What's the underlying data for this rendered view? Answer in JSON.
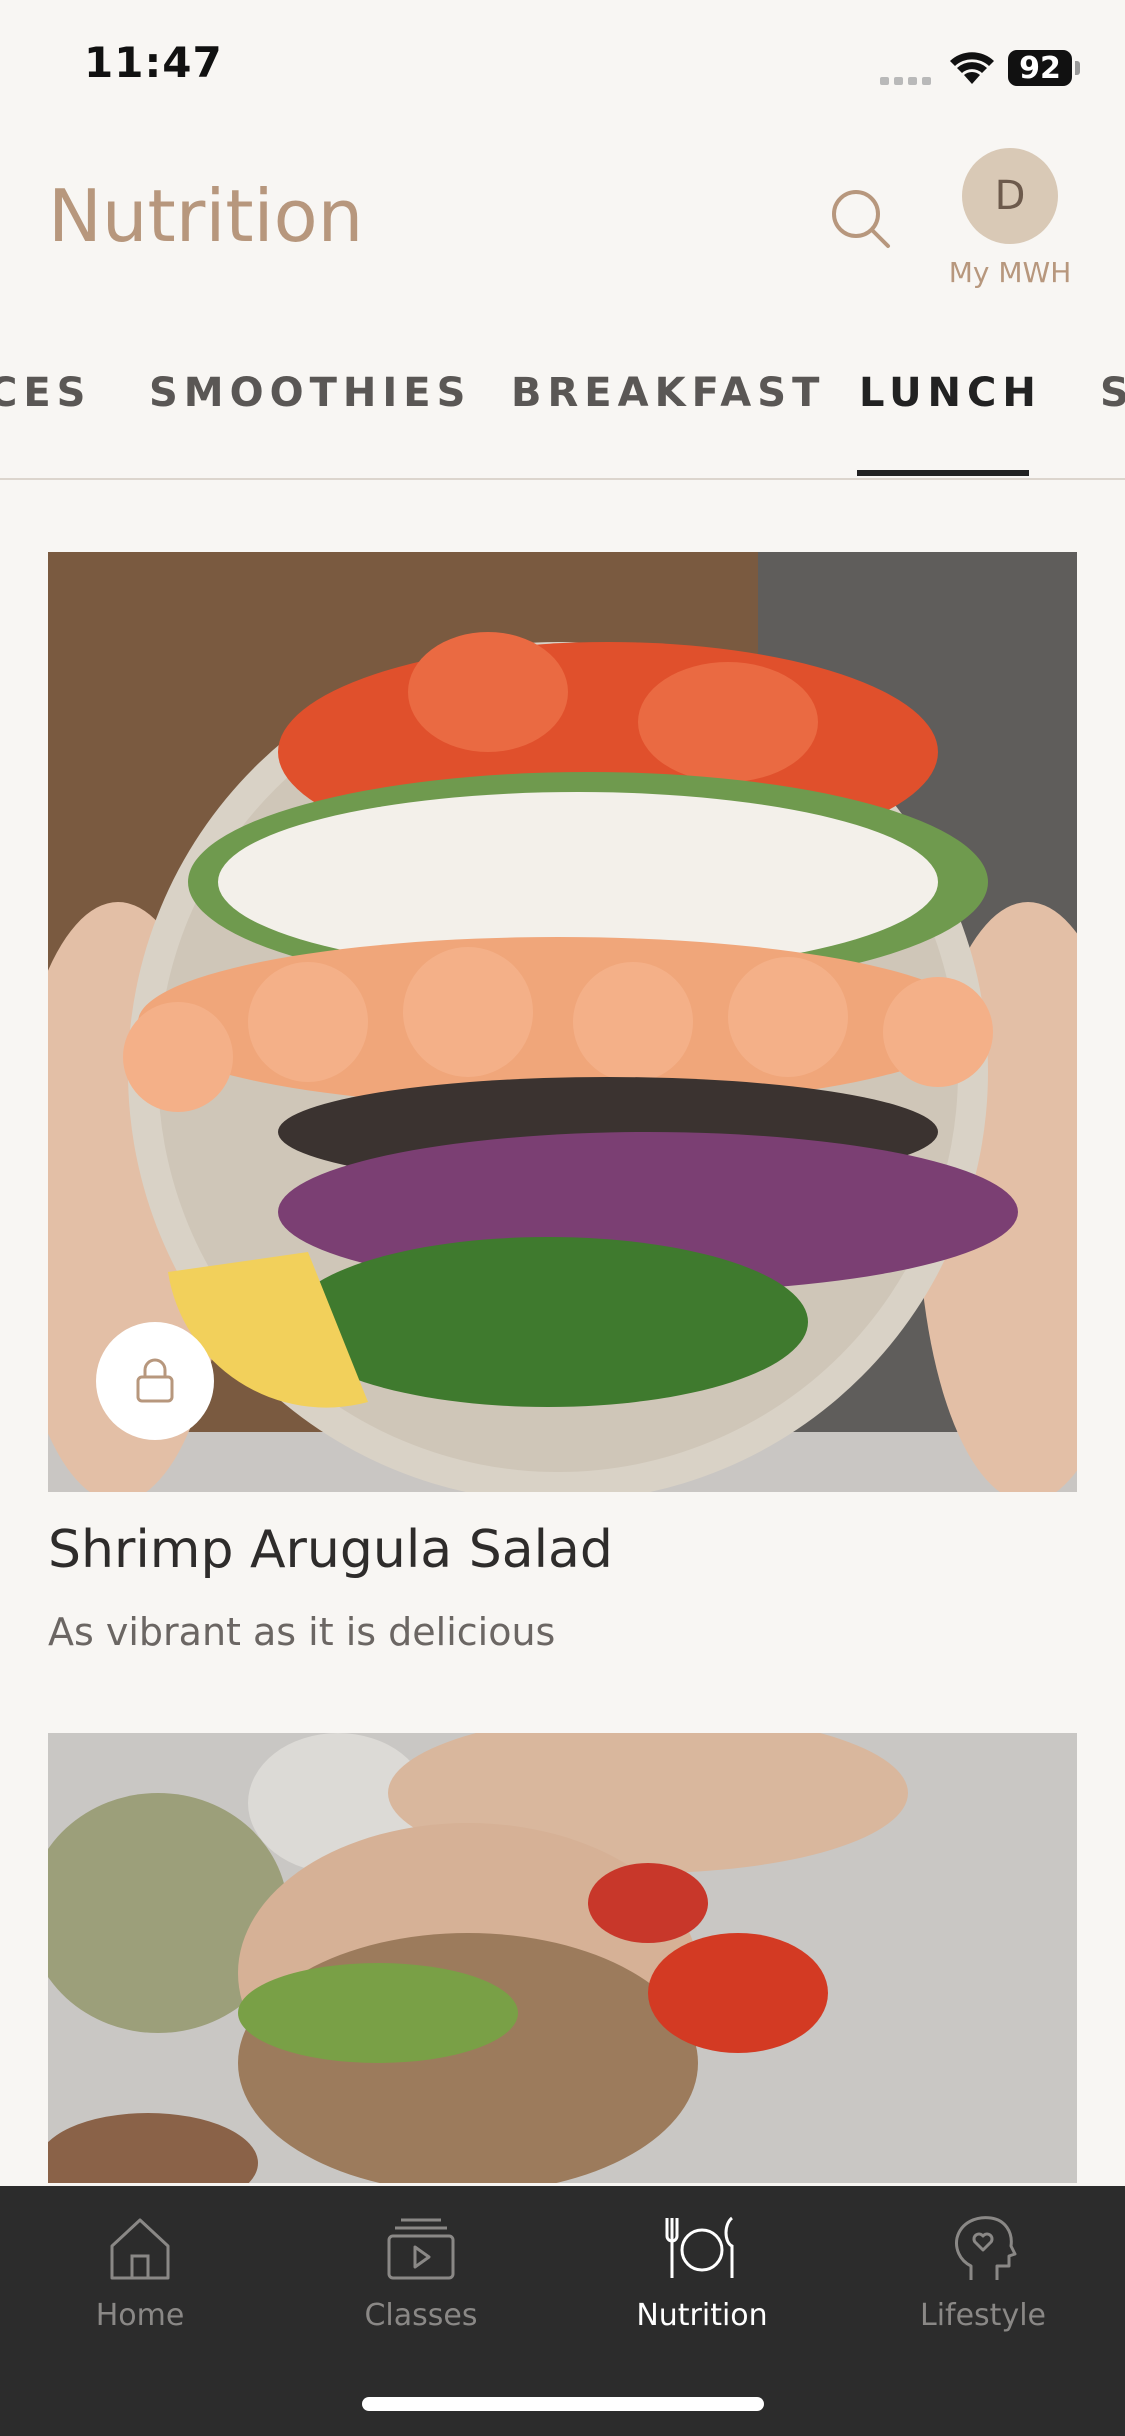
{
  "status_bar": {
    "time": "11:47",
    "battery": "92"
  },
  "header": {
    "title": "Nutrition",
    "search_icon": "search-icon",
    "avatar_initial": "D",
    "avatar_label": "My MWH"
  },
  "category_tabs": {
    "items": [
      "CES",
      "SMOOTHIES",
      "BREAKFAST",
      "LUNCH",
      "S"
    ],
    "active": "LUNCH"
  },
  "recipes": [
    {
      "title": "Shrimp Arugula Salad",
      "subtitle": "As vibrant as it is delicious",
      "locked": true
    }
  ],
  "bottom_nav": {
    "items": [
      {
        "label": "Home",
        "icon": "house-icon"
      },
      {
        "label": "Classes",
        "icon": "video-stack-icon"
      },
      {
        "label": "Nutrition",
        "icon": "plate-cutlery-icon"
      },
      {
        "label": "Lifestyle",
        "icon": "head-heart-icon"
      }
    ],
    "active": "Nutrition"
  },
  "colors": {
    "accent": "#b7977d",
    "nav_bg": "#2c2c2c",
    "page_bg": "#f8f6f3"
  }
}
